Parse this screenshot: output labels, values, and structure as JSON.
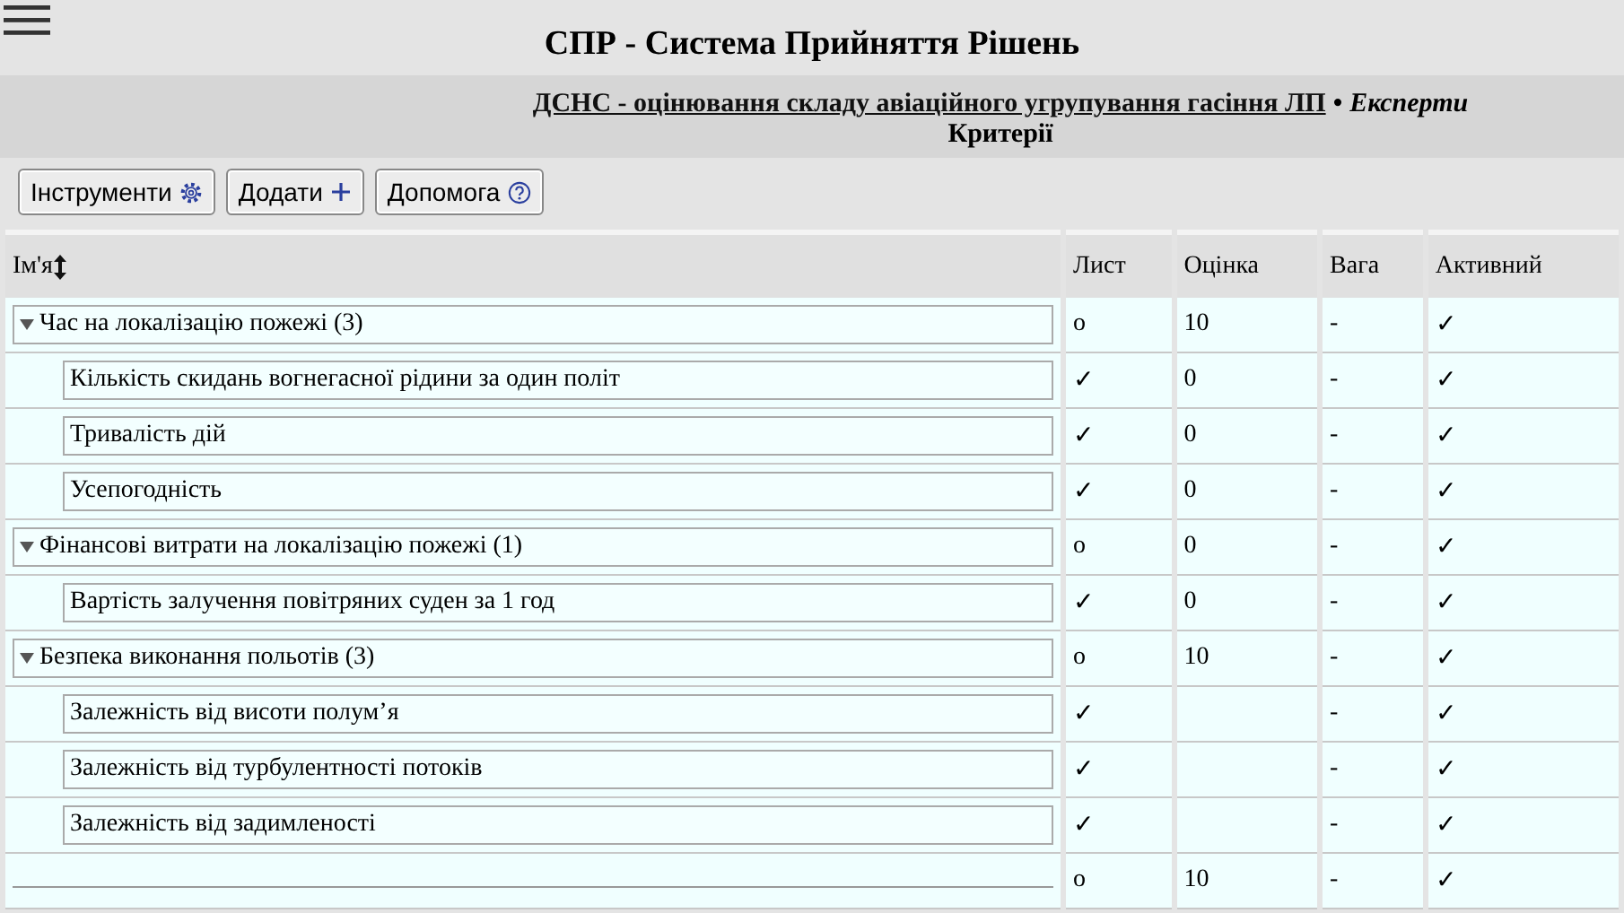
{
  "app": {
    "title": "СПР - Система Прийняття Рішень"
  },
  "breadcrumb": {
    "project": "ДСНС - оцінювання складу авіаційного угрупування гасіння ЛП",
    "separator": "•",
    "section": "Експерти",
    "page": "Критерії"
  },
  "toolbar": [
    {
      "label": "Інструменти",
      "kind": "gear"
    },
    {
      "label": "Додати",
      "kind": "plus"
    },
    {
      "label": "Допомога",
      "kind": "help"
    }
  ],
  "table": {
    "columns": [
      "Ім'я",
      "Лист",
      "Оцінка",
      "Вага",
      "Активний"
    ],
    "rows": [
      {
        "name": "Час на локалізацію пожежі (3)",
        "expanded": true,
        "leaf": "o",
        "score": "10",
        "weight": "-",
        "active": "✓",
        "children": [
          {
            "name": "Кількість скидань вогнегасної рідини за один політ",
            "leaf": "✓",
            "score": "0",
            "weight": "-",
            "active": "✓"
          },
          {
            "name": "Тривалість дій",
            "leaf": "✓",
            "score": "0",
            "weight": "-",
            "active": "✓"
          },
          {
            "name": "Усепогодність",
            "leaf": "✓",
            "score": "0",
            "weight": "-",
            "active": "✓"
          }
        ]
      },
      {
        "name": "Фінансові витрати на локалізацію пожежі (1)",
        "expanded": true,
        "leaf": "o",
        "score": "0",
        "weight": "-",
        "active": "✓",
        "children": [
          {
            "name": "Вартість залучення повітряних суден за 1 год",
            "leaf": "✓",
            "score": "0",
            "weight": "-",
            "active": "✓"
          }
        ]
      },
      {
        "name": "Безпека виконання польотів (3)",
        "expanded": true,
        "leaf": "o",
        "score": "10",
        "weight": "-",
        "active": "✓",
        "children": [
          {
            "name": "Залежність від висоти полум’я",
            "leaf": "✓",
            "weight": "-",
            "active": "✓"
          },
          {
            "name": "Залежність від турбулентності потоків",
            "leaf": "✓",
            "weight": "-",
            "active": "✓"
          },
          {
            "name": "Залежність від задимленості",
            "leaf": "✓",
            "weight": "-",
            "active": "✓"
          }
        ]
      },
      {
        "leaf": "o",
        "score": "10",
        "weight": "-",
        "active": "✓"
      }
    ]
  }
}
